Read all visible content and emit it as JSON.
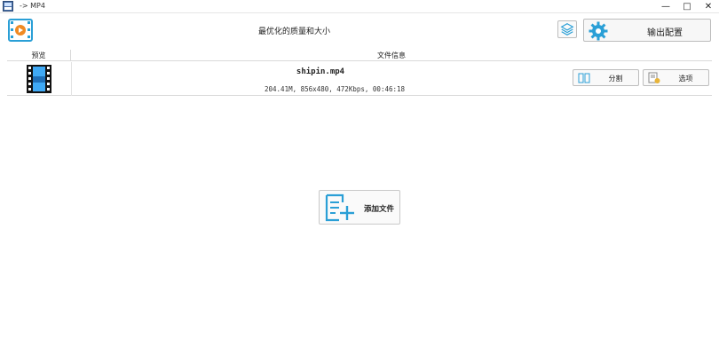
{
  "window": {
    "title": "-> MP4",
    "minimize": "—",
    "maximize": "□",
    "close": "✕"
  },
  "toolbar": {
    "quality_text": "最优化的质量和大小",
    "output_button_label": "输出配置",
    "icons": {
      "format": "video-format-icon",
      "layers": "layers-icon",
      "settings": "gear-icon"
    }
  },
  "table": {
    "headers": {
      "preview": "预览",
      "info": "文件信息"
    },
    "rows": [
      {
        "name": "shipin.mp4",
        "meta": "204.41M, 856x480, 472Kbps, 00:46:18",
        "split_label": "分割",
        "options_label": "选项"
      }
    ]
  },
  "add_file": {
    "label": "添加文件",
    "icon": "add-file-icon"
  },
  "colors": {
    "accent": "#2a9fd6",
    "border": "#bdbdbd"
  }
}
